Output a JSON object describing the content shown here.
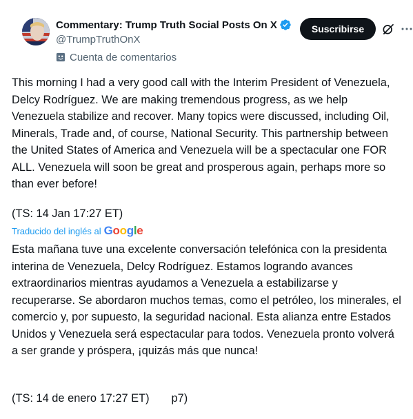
{
  "header": {
    "display_name": "Commentary: Trump Truth Social Posts On X",
    "handle": "@TrumpTruthOnX",
    "account_label": "Cuenta de comentarios",
    "subscribe_label": "Suscribirse"
  },
  "post": {
    "original_text": "This morning I had a very good call with the Interim President of Venezuela, Delcy Rodríguez. We are making tremendous progress, as we help Venezuela stabilize and recover. Many topics were discussed, including Oil, Minerals, Trade and, of course, National Security. This partnership between the United States of America and Venezuela will be a spectacular one FOR ALL. Venezuela will soon be great and prosperous again, perhaps more so than ever before!",
    "original_timestamp": "(TS: 14 Jan 17:27 ET)",
    "translation_note": "Traducido del inglés al",
    "translation_provider": "Google",
    "translated_text": "Esta mañana tuve una excelente conversación telefónica con la presidenta interina de Venezuela, Delcy Rodríguez. Estamos logrando avances extraordinarios mientras ayudamos a Venezuela a estabilizarse y recuperarse. Se abordaron muchos temas, como el petróleo, los minerales, el comercio y, por supuesto, la seguridad nacional. Esta alianza entre Estados Unidos y Venezuela será espectacular para todos. Venezuela pronto volverá a ser grande y próspera, ¡quizás más que nunca!",
    "translated_timestamp": "(TS: 14 de enero 17:27 ET)",
    "page_tag": "p7)"
  },
  "icons": {
    "verified": "verified-badge-icon",
    "account_label": "mask-icon",
    "grok": "grok-icon",
    "more": "more-options-icon"
  },
  "colors": {
    "verified_blue": "#1d9bf0",
    "muted_text": "#536471",
    "button_bg": "#0f1419",
    "link_blue": "#1d9bf0"
  }
}
